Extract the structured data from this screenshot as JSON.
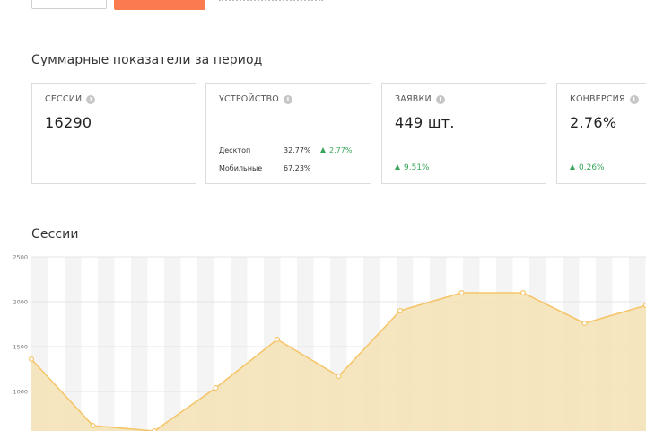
{
  "summary": {
    "title": "Суммарные показатели за период",
    "cards": {
      "sessions": {
        "label": "СЕССИИ",
        "value": "16290"
      },
      "device": {
        "label": "УСТРОЙСТВО",
        "rows": [
          {
            "name": "Десктоп",
            "pct": "32.77%",
            "delta": "2.77%"
          },
          {
            "name": "Мобильные",
            "pct": "67.23%",
            "delta": ""
          }
        ]
      },
      "requests": {
        "label": "ЗАЯВКИ",
        "value": "449 шт.",
        "delta": "9.51%"
      },
      "conversion": {
        "label": "КОНВЕРСИЯ",
        "value": "2.76%",
        "delta": "0.26%"
      }
    },
    "info_glyph": "i"
  },
  "sessions_chart": {
    "title": "Сессии"
  },
  "colors": {
    "accent": "#f97b4f",
    "positive": "#3aa55b",
    "line": "#f5c56a",
    "area": "#f3e2b4"
  },
  "chart_data": {
    "type": "area",
    "title": "Сессии",
    "xlabel": "",
    "ylabel": "",
    "ylim": [
      0,
      2500
    ],
    "yticks": [
      2500,
      2000,
      1500,
      1000
    ],
    "grid": true,
    "series": [
      {
        "values": [
          1360,
          620,
          560,
          1040,
          1580,
          1170,
          1900,
          2100,
          2100,
          1760,
          1960
        ]
      }
    ]
  }
}
